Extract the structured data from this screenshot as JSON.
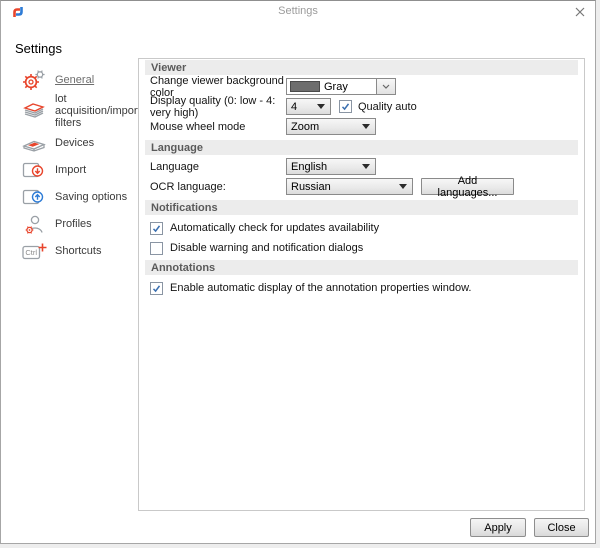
{
  "window": {
    "title": "Settings"
  },
  "sidebar": {
    "heading": "Settings",
    "items": [
      {
        "label": "General",
        "icon": "gears-icon",
        "selected": true
      },
      {
        "label": "lot acquisition/import filters",
        "icon": "paper-stack-icon",
        "selected": false
      },
      {
        "label": "Devices",
        "icon": "scanner-icon",
        "selected": false
      },
      {
        "label": "Import",
        "icon": "import-document-icon",
        "selected": false
      },
      {
        "label": "Saving options",
        "icon": "save-document-icon",
        "selected": false
      },
      {
        "label": "Profiles",
        "icon": "user-profile-icon",
        "selected": false
      },
      {
        "label": "Shortcuts",
        "icon": "ctrl-key-icon",
        "selected": false,
        "key_glyph": "Ctrl"
      }
    ]
  },
  "sections": {
    "viewer": {
      "title": "Viewer",
      "bg_color_label": "Change viewer background color",
      "bg_color_value": "Gray",
      "quality_label": "Display quality (0: low - 4: very high)",
      "quality_value": "4",
      "quality_auto_label": "Quality auto",
      "quality_auto_checked": true,
      "wheel_label": "Mouse wheel mode",
      "wheel_value": "Zoom"
    },
    "language": {
      "title": "Language",
      "ui_language_label": "Language",
      "ui_language_value": "English",
      "ocr_language_label": "OCR language:",
      "ocr_language_value": "Russian",
      "add_languages_button": "Add languages..."
    },
    "notifications": {
      "title": "Notifications",
      "check_updates_label": "Automatically check for updates availability",
      "check_updates_checked": true,
      "disable_dialogs_label": "Disable warning and notification dialogs",
      "disable_dialogs_checked": false
    },
    "annotations": {
      "title": "Annotations",
      "auto_display_label": "Enable automatic display of the annotation properties window.",
      "auto_display_checked": true
    }
  },
  "footer": {
    "apply_label": "Apply",
    "close_label": "Close"
  },
  "colors": {
    "accent_red": "#e8452c",
    "accent_blue": "#2e7cd6",
    "check_blue": "#3a6fb0",
    "icon_gray": "#9aa0a6",
    "section_band_bg": "#ececec",
    "section_title_text": "#5a5a5a",
    "swatch_gray": "#6d6d6d"
  }
}
